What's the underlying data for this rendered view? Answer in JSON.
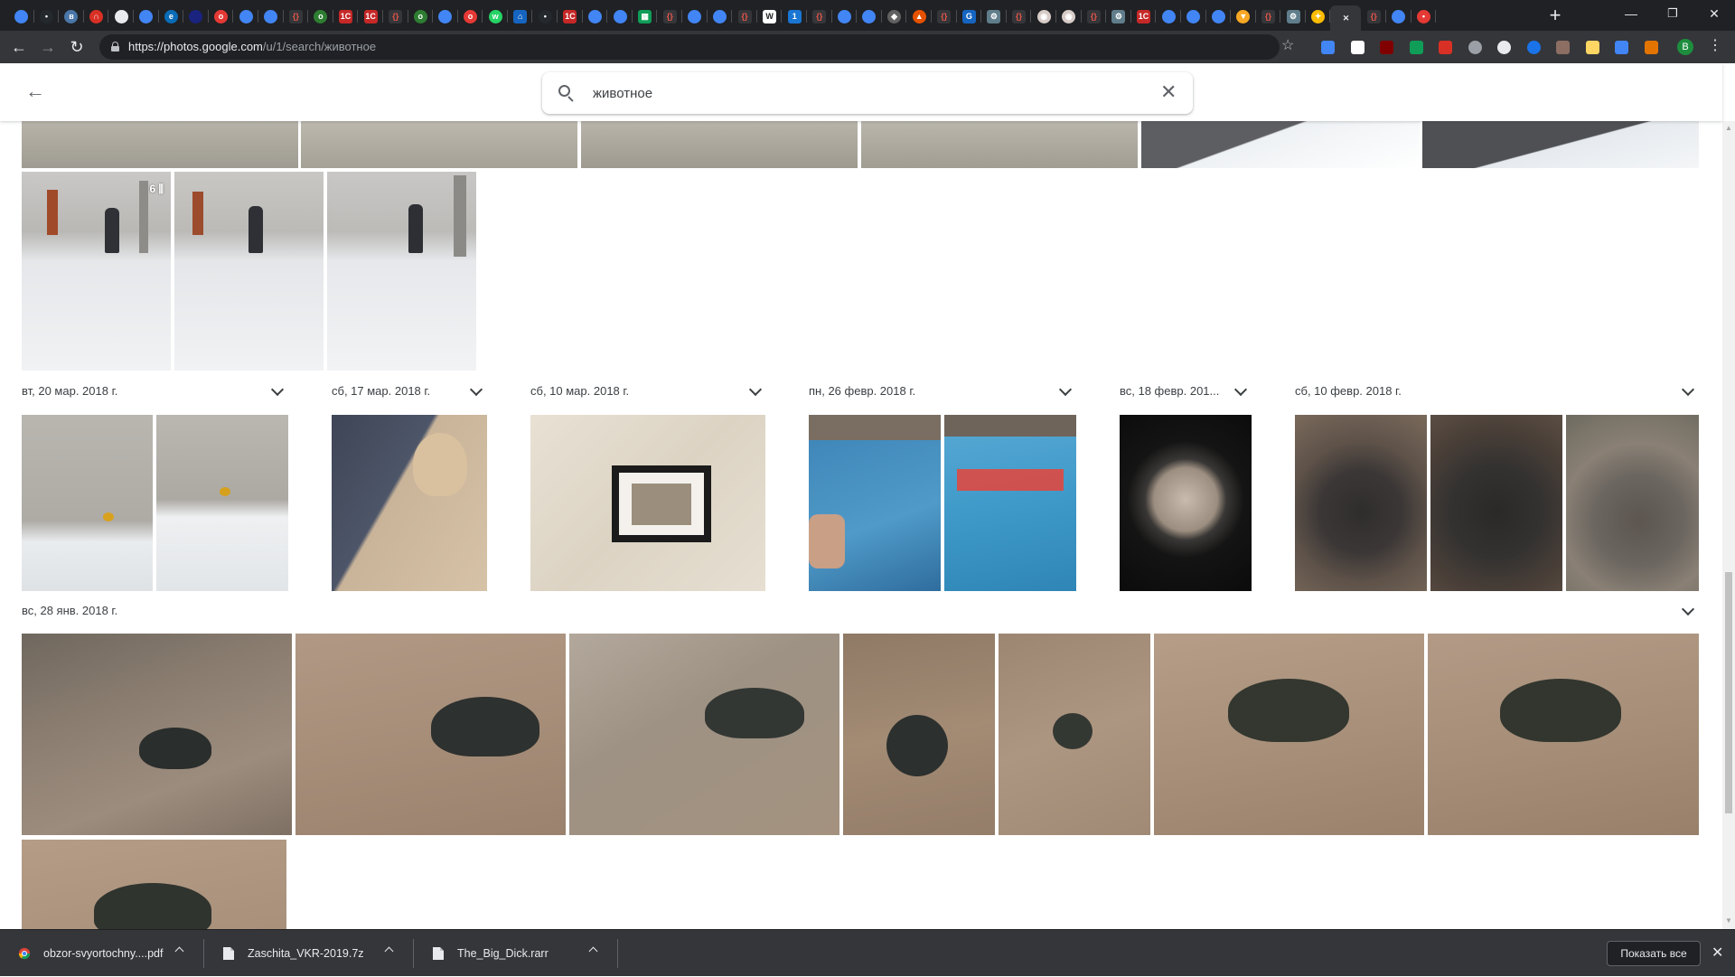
{
  "browser": {
    "url_host": "https://photos.google.com",
    "url_path": "/u/1/search/животное",
    "tab_favicons": [
      "chrome",
      "github",
      "vk",
      "red",
      "guru",
      "chrome",
      "edge",
      "dark",
      "opera",
      "chrome",
      "chrome",
      "code",
      "odnoklassniki",
      "1c",
      "1c",
      "code",
      "odnoklassniki",
      "chrome",
      "opera",
      "whatsapp",
      "lock",
      "github",
      "1c",
      "chrome",
      "chrome",
      "sheets",
      "code",
      "chrome",
      "chrome",
      "code",
      "wiki",
      "one",
      "code",
      "chrome",
      "chrome",
      "ethereum",
      "fire",
      "code",
      "goto",
      "settings",
      "code",
      "food",
      "food",
      "code",
      "settings",
      "1c",
      "chrome",
      "chrome",
      "chrome",
      "shield",
      "code",
      "settings",
      "photos",
      "close-active",
      "code",
      "chrome",
      "mic"
    ],
    "window_controls": {
      "minimize": "—",
      "restore": "❐",
      "close": "✕"
    },
    "new_tab": "+",
    "profile_initial": "B",
    "extensions": [
      "translate",
      "notion",
      "ublock",
      "drive",
      "redsq",
      "circle",
      "pocket",
      "blue-circle",
      "owl",
      "moon",
      "tv",
      "cookie"
    ]
  },
  "app": {
    "search_query": "животное",
    "back_label": "←",
    "clear_label": "✕"
  },
  "groups": [
    {
      "date": "вт, 20 мар. 2018 г."
    },
    {
      "date": "сб, 17 мар. 2018 г."
    },
    {
      "date": "сб, 10 мар. 2018 г."
    },
    {
      "date": "пн, 26 февр. 2018 г."
    },
    {
      "date": "вс, 18 февр. 201..."
    },
    {
      "date": "сб, 10 февр. 2018 г."
    },
    {
      "date": "вс, 28 янв. 2018 г."
    }
  ],
  "burst_count": "6",
  "downloads": [
    {
      "name": "obzor-svyortochny....pdf",
      "icon": "chrome-icon"
    },
    {
      "name": "Zaschita_VKR-2019.7z",
      "icon": "file-icon"
    },
    {
      "name": "The_Big_Dick.rarr",
      "icon": "file-icon"
    }
  ],
  "show_all_label": "Показать все",
  "shelf_close": "✕"
}
